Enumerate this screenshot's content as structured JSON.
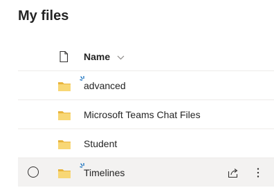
{
  "header": {
    "title": "My files"
  },
  "list": {
    "columns": {
      "type_icon": "document-icon",
      "name": "Name"
    },
    "rows": [
      {
        "name": "advanced",
        "icon": "folder-icon",
        "is_new": true,
        "selected": false
      },
      {
        "name": "Microsoft Teams Chat Files",
        "icon": "folder-icon",
        "is_new": false,
        "selected": false
      },
      {
        "name": "Student",
        "icon": "folder-icon",
        "is_new": false,
        "selected": false
      },
      {
        "name": "Timelines",
        "icon": "folder-icon",
        "is_new": true,
        "selected": true
      }
    ]
  },
  "colors": {
    "folder": "#f8d775",
    "folder_back": "#e8b43c",
    "new_indicator": "#0f6cbd",
    "row_hover": "#f3f2f1"
  }
}
